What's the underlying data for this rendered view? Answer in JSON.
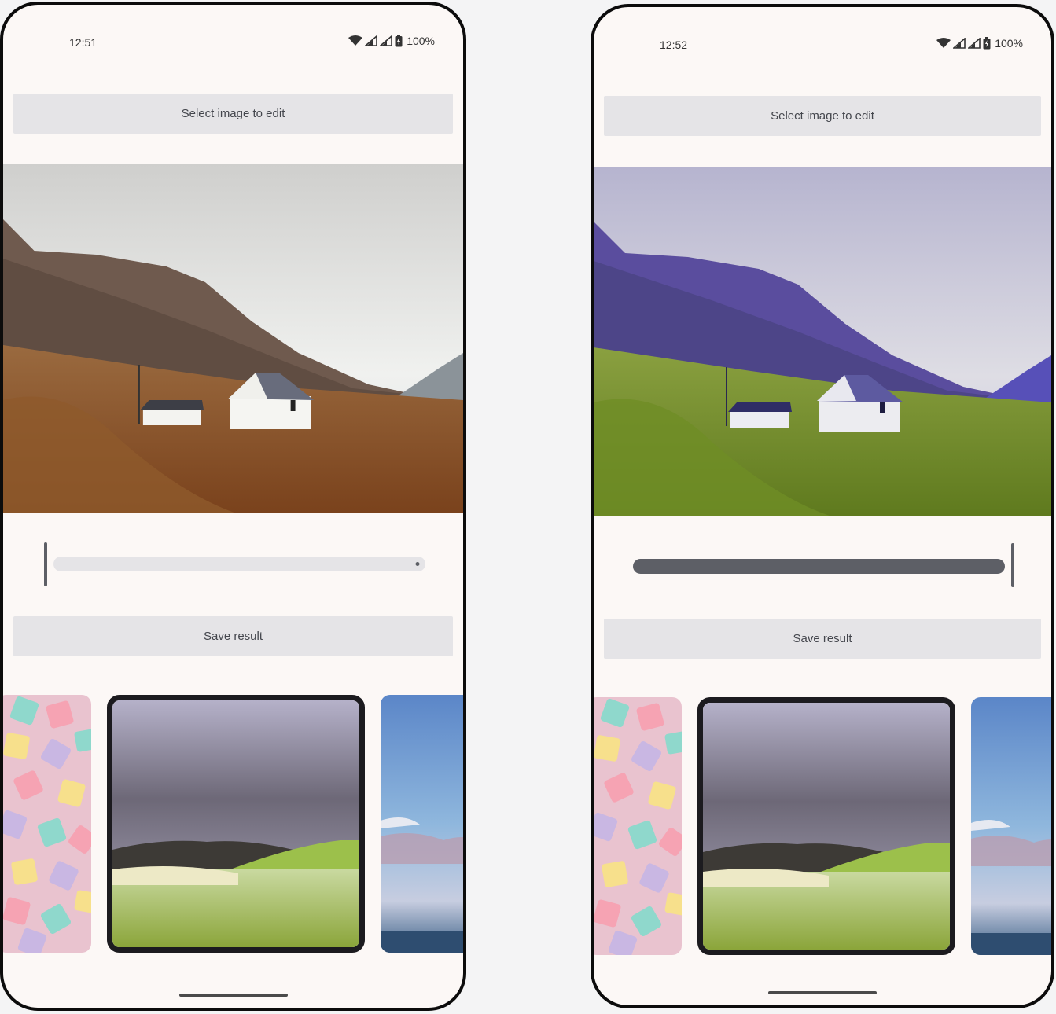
{
  "screens": [
    {
      "time": "12:51",
      "battery": "100%",
      "select_button": "Select image to edit",
      "save_button": "Save result",
      "filter_strength": 0.0,
      "main_photo": "highland-cottage-original",
      "thumbnails": [
        "pastel-candy",
        "green-meadow-selected",
        "sea-sky"
      ]
    },
    {
      "time": "12:52",
      "battery": "100%",
      "select_button": "Select image to edit",
      "save_button": "Save result",
      "filter_strength": 1.0,
      "main_photo": "highland-cottage-filtered",
      "thumbnails": [
        "pastel-candy",
        "green-meadow-selected",
        "sea-sky"
      ]
    }
  ],
  "icons": [
    "wifi-icon",
    "signal-icon",
    "signal-icon",
    "battery-icon"
  ],
  "colors": {
    "button_bg": "#e5e4e7",
    "screen_bg": "#fcf8f6",
    "slider_active": "#5d5f66",
    "slider_track": "#e5e4e7",
    "frame": "#0c0c0c"
  }
}
